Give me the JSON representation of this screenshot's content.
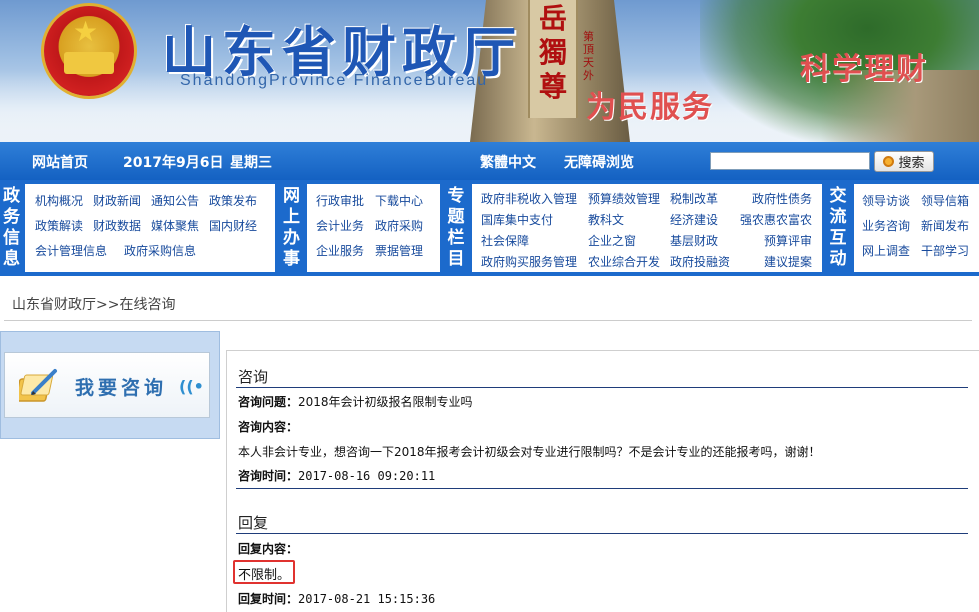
{
  "banner": {
    "title": "山东省财政厅",
    "subtitle": "ShandongProvince  FinanceBureau",
    "slogan_right": "科学理财",
    "slogan_center": "为民服务",
    "rock_inscription": "岳獨尊",
    "rock_small": "第頂天外"
  },
  "topnav": {
    "home": "网站首页",
    "date": "2017年9月6日",
    "weekday": "星期三",
    "traditional": "繁體中文",
    "accessible": "无障碍浏览",
    "search_placeholder": "",
    "search_button": "搜索"
  },
  "menu": {
    "gov_info": {
      "label": [
        "政",
        "务",
        "信",
        "息"
      ],
      "items": [
        "机构概况",
        "财政新闻",
        "通知公告",
        "政策发布",
        "政策解读",
        "财政数据",
        "媒体聚焦",
        "国内财经",
        "会计管理信息",
        "政府采购信息"
      ]
    },
    "online": {
      "label": [
        "网",
        "上",
        "办",
        "事"
      ],
      "items": [
        "行政审批",
        "下载中心",
        "会计业务",
        "政府采购",
        "企业服务",
        "票据管理"
      ]
    },
    "special": {
      "label": [
        "专",
        "题",
        "栏",
        "目"
      ],
      "items": [
        "政府非税收入管理",
        "预算绩效管理",
        "税制改革",
        "政府性债务",
        "国库集中支付",
        "教科文",
        "经济建设",
        "强农惠农富农",
        "社会保障",
        "企业之窗",
        "基层财政",
        "预算评审",
        "政府购买服务管理",
        "农业综合开发",
        "政府投融资",
        "建议提案"
      ]
    },
    "interact": {
      "label": [
        "交",
        "流",
        "互",
        "动"
      ],
      "items": [
        "领导访谈",
        "领导信箱",
        "业务咨询",
        "新闻发布",
        "网上调查",
        "干部学习"
      ]
    }
  },
  "breadcrumb": "山东省财政厅>>在线咨询",
  "consult_button": "我要咨询",
  "consult": {
    "section_title": "咨询",
    "question_label": "咨询问题：",
    "question_value": "2018年会计初级报名限制专业吗",
    "content_label": "咨询内容：",
    "content_value": "本人非会计专业，想咨询一下2018年报考会计初级会对专业进行限制吗？不是会计专业的还能报考吗，谢谢！",
    "time_label": "咨询时间：",
    "time_value": "2017-08-16 09:20:11"
  },
  "reply": {
    "section_title": "回复",
    "content_label": "回复内容：",
    "content_value": "不限制。",
    "time_label": "回复时间：",
    "time_value": "2017-08-21 15:15:36"
  },
  "colors": {
    "nav_blue": "#1c6acc",
    "title_blue": "#1f57b5",
    "slogan_red": "#e05050",
    "highlight_red": "#e0322f"
  }
}
